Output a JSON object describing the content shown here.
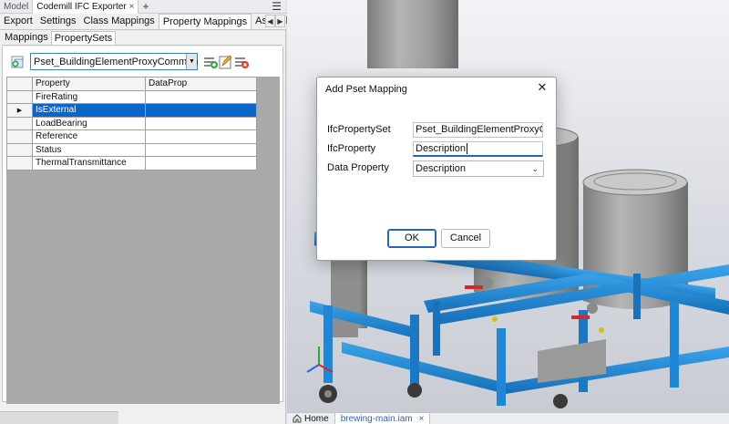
{
  "panel": {
    "top_tabs": [
      "Model",
      "Codemill IFC Exporter"
    ],
    "close_glyph": "×",
    "add_glyph": "+",
    "menu_glyph": "☰",
    "main_tabs": [
      "Export",
      "Settings",
      "Class Mappings",
      "Property Mappings",
      "Assembly Co"
    ],
    "sub_tabs": [
      "Mappings",
      "PropertySets"
    ],
    "pset_selected": "Pset_BuildingElementProxyCommon",
    "grid": {
      "headers": [
        "Property",
        "DataProp"
      ],
      "rows": [
        {
          "property": "FireRating",
          "dataprop": ""
        },
        {
          "property": "IsExternal",
          "dataprop": ""
        },
        {
          "property": "LoadBearing",
          "dataprop": ""
        },
        {
          "property": "Reference",
          "dataprop": ""
        },
        {
          "property": "Status",
          "dataprop": ""
        },
        {
          "property": "ThermalTransmittance",
          "dataprop": ""
        }
      ],
      "selected_row": 1
    }
  },
  "doc_tabs": [
    {
      "label": "Home",
      "icon": "home-icon"
    },
    {
      "label": "brewing-main.iam",
      "icon": "",
      "close": "×"
    }
  ],
  "dialog": {
    "title": "Add Pset Mapping",
    "close": "✕",
    "fields": {
      "ifc_property_set_label": "IfcPropertySet",
      "ifc_property_set_value": "Pset_BuildingElementProxyCommo",
      "ifc_property_label": "IfcProperty",
      "ifc_property_value": "Description",
      "data_property_label": "Data Property",
      "data_property_value": "Description"
    },
    "ok": "OK",
    "cancel": "Cancel"
  },
  "colors": {
    "accent": "#2a64b8",
    "selection": "#0a67c9",
    "frame_blue": "#1f87d6",
    "tank_gray": "#a9a9a9"
  }
}
